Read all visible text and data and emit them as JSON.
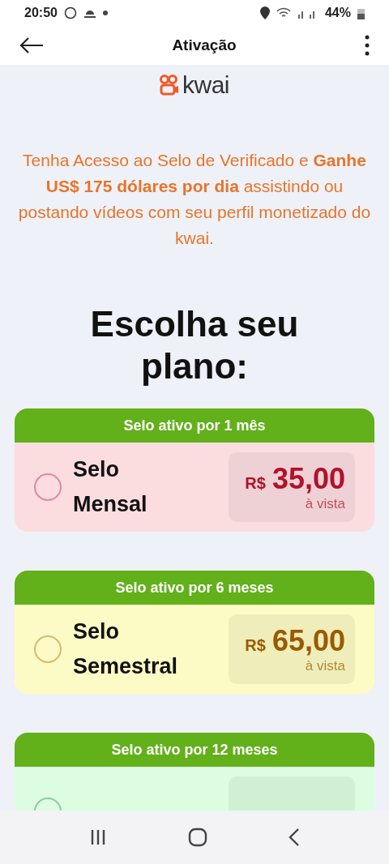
{
  "status_bar": {
    "time": "20:50",
    "battery": "44%"
  },
  "app_bar": {
    "title": "Ativação"
  },
  "brand": {
    "name": "kwai"
  },
  "promo": "Tenha Acesso ao Selo de Verificado e **Ganhe US$ 175 dólares por dia** assistindo ou postando vídeos com seu perfil monetizado do kwai.",
  "heading": "Escolha seu plano:",
  "plans": [
    {
      "header": "Selo ativo por 1 mês",
      "name": "Selo Mensal",
      "currency": "R$",
      "price": "35,00",
      "terms": "à vista",
      "color": "#fbdde0",
      "selected": false
    },
    {
      "header": "Selo ativo por 6 meses",
      "name": "Selo Semestral",
      "currency": "R$",
      "price": "65,00",
      "terms": "à vista",
      "color": "#fcfbc5",
      "selected": false
    },
    {
      "header": "Selo ativo por 12 meses",
      "color": "#dcfde2",
      "selected": false
    }
  ]
}
